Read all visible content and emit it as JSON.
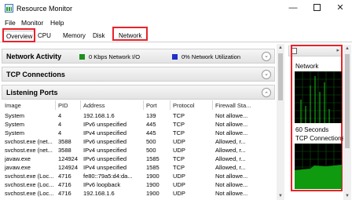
{
  "window": {
    "title": "Resource Monitor",
    "min_glyph": "—",
    "close_glyph": "✕"
  },
  "menu": [
    "File",
    "Monitor",
    "Help"
  ],
  "tabs": [
    "Overview",
    "CPU",
    "Memory",
    "Disk",
    "Network"
  ],
  "sections": {
    "network_activity": {
      "title": "Network Activity",
      "io_label": "0 Kbps Network I/O",
      "util_label": "0% Network Utilization",
      "io_color": "#1f8f1f",
      "util_color": "#2030c8"
    },
    "tcp": {
      "title": "TCP Connections"
    },
    "listening": {
      "title": "Listening Ports"
    }
  },
  "chevron_glyph": "⌄",
  "columns": [
    "Image",
    "PID",
    "Address",
    "Port",
    "Protocol",
    "Firewall Sta..."
  ],
  "rows": [
    [
      "System",
      "4",
      "192.168.1.6",
      "139",
      "TCP",
      "Not allowe..."
    ],
    [
      "System",
      "4",
      "IPv6 unspecified",
      "445",
      "TCP",
      "Not allowe..."
    ],
    [
      "System",
      "4",
      "IPv4 unspecified",
      "445",
      "TCP",
      "Not allowe..."
    ],
    [
      "svchost.exe (net...",
      "3588",
      "IPv6 unspecified",
      "500",
      "UDP",
      "Allowed, r..."
    ],
    [
      "svchost.exe (net...",
      "3588",
      "IPv4 unspecified",
      "500",
      "UDP",
      "Allowed, r..."
    ],
    [
      "javaw.exe",
      "124924",
      "IPv6 unspecified",
      "1585",
      "TCP",
      "Allowed, r..."
    ],
    [
      "javaw.exe",
      "124924",
      "IPv4 unspecified",
      "1585",
      "TCP",
      "Allowed, r..."
    ],
    [
      "svchost.exe (Loc...",
      "4716",
      "fe80::79a5:d4:da...",
      "1900",
      "UDP",
      "Not allowe..."
    ],
    [
      "svchost.exe (Loc...",
      "4716",
      "IPv6 loopback",
      "1900",
      "UDP",
      "Not allowe..."
    ],
    [
      "svchost.exe (Loc...",
      "4716",
      "192.168.1.6",
      "1900",
      "UDP",
      "Not allowe..."
    ]
  ],
  "right_panel": {
    "network_label": "Network",
    "seconds_label": "60 Seconds",
    "tcp_label": "TCP Connections",
    "graph_color": "#18c018"
  },
  "scroll_glyphs": {
    "up": "▲",
    "down": "▼"
  }
}
